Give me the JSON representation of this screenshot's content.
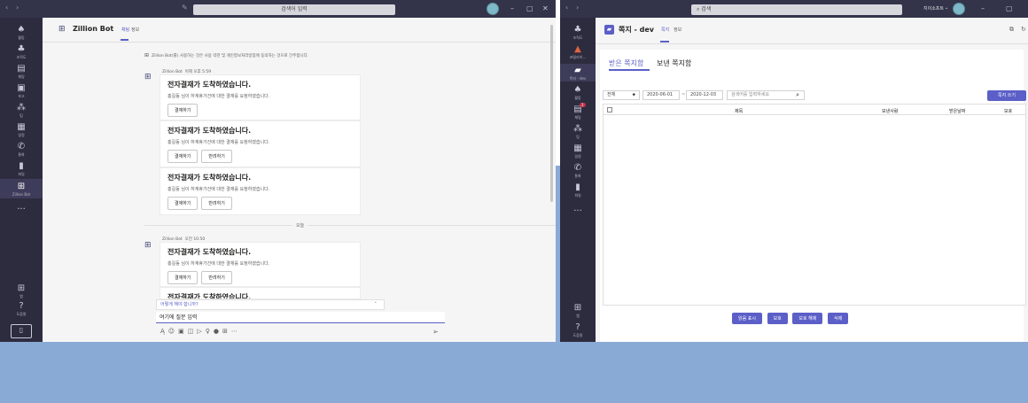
{
  "left": {
    "search_placeholder": "검색어 입력",
    "rail": [
      {
        "icon": "bell",
        "label": "활동"
      },
      {
        "icon": "org",
        "label": "조직도"
      },
      {
        "icon": "chat",
        "label": "채팅"
      },
      {
        "icon": "doc",
        "label": "보고"
      },
      {
        "icon": "team",
        "label": "팀"
      },
      {
        "icon": "cal",
        "label": "일정"
      },
      {
        "icon": "call",
        "label": "통화"
      },
      {
        "icon": "file",
        "label": "파일"
      },
      {
        "icon": "bot",
        "label": "Zillion Bot"
      },
      {
        "icon": "more",
        "label": "..."
      }
    ],
    "rail_bottom": [
      {
        "label": "앱"
      },
      {
        "label": "도움말"
      }
    ],
    "app_name": "Zillion Bot",
    "tabs": [
      "채팅",
      "정보"
    ],
    "privacy_notice": "Zillion Bot(를) 사용하는 것은 사용 약관 및 개인정보처리방침에 동의하는 것으로 간주합니다.",
    "messages": [
      {
        "sender": "Zillion Bot",
        "time": "어제 오후 5:59",
        "title": "전자결재가 도착하였습니다.",
        "desc": "홍길동 님이 하계휴가건에 대한 결재를 요청하였습니다.",
        "buttons": [
          "결재하기"
        ]
      },
      {
        "title": "전자결재가 도착하였습니다.",
        "desc": "홍길동 님이 하계휴가건에 대한 결재를 요청하였습니다.",
        "buttons": [
          "결재하기",
          "반려하기"
        ]
      },
      {
        "title": "전자결재가 도착하였습니다.",
        "desc": "홍길동 님이 하계휴가건에 대한 결재를 요청하였습니다.",
        "buttons": [
          "결재하기",
          "반려하기"
        ]
      }
    ],
    "day_divider": "오늘",
    "messages2": [
      {
        "sender": "Zillion Bot",
        "time": "오전 10:50",
        "title": "전자결재가 도착하였습니다.",
        "desc": "홍길동 님이 하계휴가건에 대한 결재를 요청하였습니다.",
        "buttons": [
          "결재하기",
          "반려하기"
        ]
      },
      {
        "title": "전자결재가 도착하였습니다."
      }
    ],
    "suggestion": "어떻게 해야 합니까?",
    "compose_value": "여기에 질문 입력"
  },
  "right": {
    "search_placeholder": "검색",
    "user_name": "지이소프트",
    "rail": [
      {
        "icon": "org",
        "label": "조직도"
      },
      {
        "icon": "flame",
        "label": "포털라이..."
      },
      {
        "icon": "memo",
        "label": "쪽지 - dev"
      },
      {
        "icon": "bell",
        "label": "활동"
      },
      {
        "icon": "chat",
        "label": "채팅",
        "badge": "1"
      },
      {
        "icon": "team",
        "label": "팀"
      },
      {
        "icon": "cal",
        "label": "일정"
      },
      {
        "icon": "call",
        "label": "통화"
      },
      {
        "icon": "file",
        "label": "파일"
      },
      {
        "icon": "more",
        "label": "..."
      }
    ],
    "rail_bottom": [
      {
        "label": "앱"
      },
      {
        "label": "도움말"
      }
    ],
    "app_name": "쪽지 - dev",
    "tabs": [
      "쪽지",
      "정보"
    ],
    "inner_tabs": [
      "받은 쪽지함",
      "보낸 쪽지함"
    ],
    "filter_select": "전체",
    "date_from": "2020-06-01",
    "date_to": "2020-12-03",
    "search_input_placeholder": "검색어를 입력하세요",
    "write_button": "쪽지 쓰기",
    "columns": [
      "제목",
      "보낸사람",
      "받은날짜",
      "보호"
    ],
    "actions": [
      "읽음 표시",
      "보호",
      "보호 해제",
      "삭제"
    ],
    "accent": "#5b5fc7"
  }
}
